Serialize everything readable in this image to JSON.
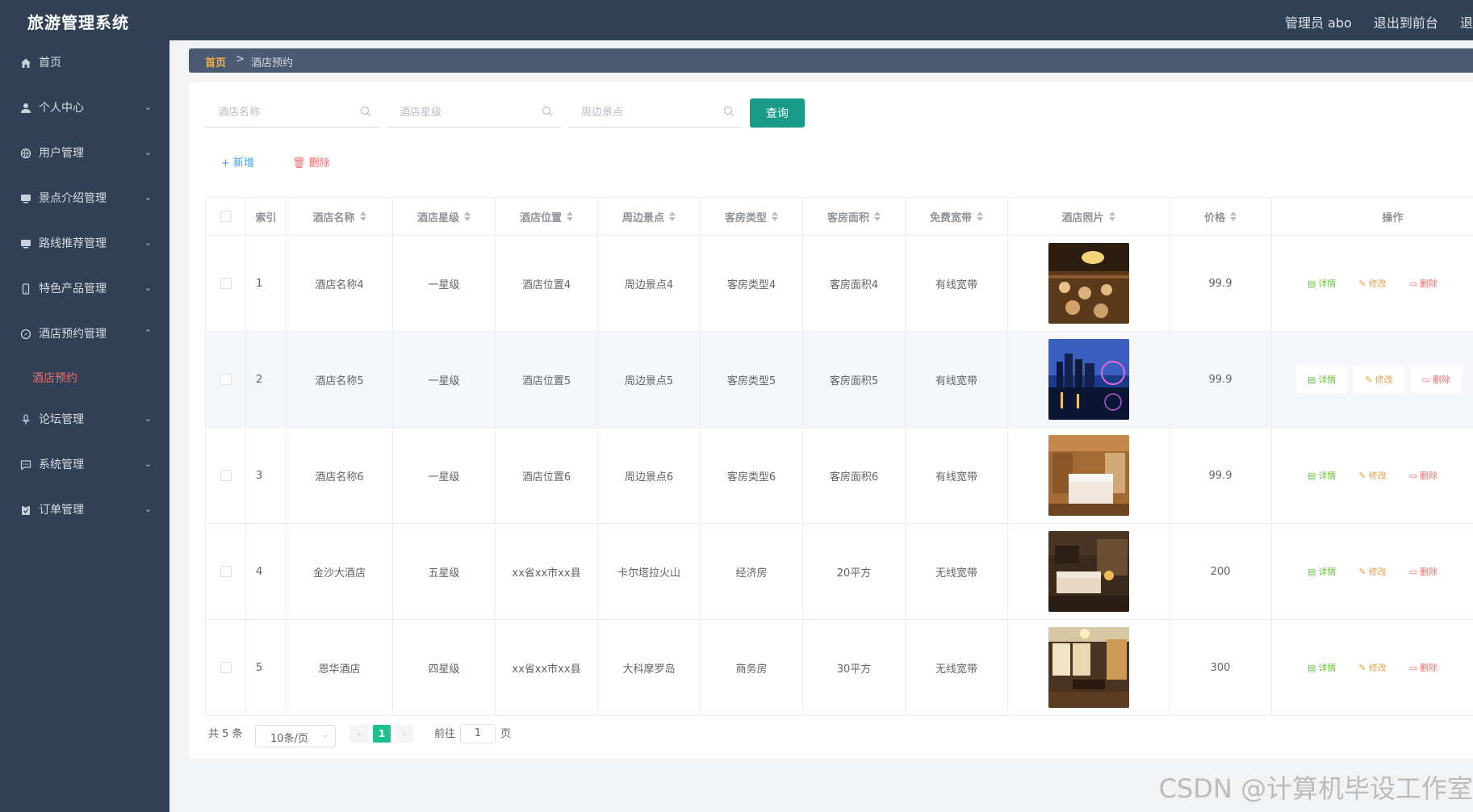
{
  "header": {
    "app_title": "旅游管理系统",
    "user_label": "管理员 abo",
    "front_link": "退出到前台",
    "logout": "退"
  },
  "sidebar": {
    "items": [
      {
        "label": "首页",
        "icon": "home-icon"
      },
      {
        "label": "个人中心",
        "icon": "user-icon"
      },
      {
        "label": "用户管理",
        "icon": "globe-icon"
      },
      {
        "label": "景点介绍管理",
        "icon": "monitor-icon"
      },
      {
        "label": "路线推荐管理",
        "icon": "monitor-icon"
      },
      {
        "label": "特色产品管理",
        "icon": "phone-icon"
      },
      {
        "label": "酒店预约管理",
        "icon": "compass-icon"
      },
      {
        "label": "论坛管理",
        "icon": "mic-icon"
      },
      {
        "label": "系统管理",
        "icon": "chat-icon"
      },
      {
        "label": "订单管理",
        "icon": "clipboard-icon"
      }
    ],
    "active_sub": "酒店预约"
  },
  "breadcrumb": {
    "home": "首页",
    "separator": ">",
    "current": "酒店预约"
  },
  "search": {
    "hotel_name_placeholder": "酒店名称",
    "hotel_star_placeholder": "酒店星级",
    "nearby_placeholder": "周边景点",
    "query_label": "查询"
  },
  "toolbar": {
    "add_label": "新增",
    "delete_label": "删除"
  },
  "table": {
    "columns": [
      "索引",
      "酒店名称",
      "酒店星级",
      "酒店位置",
      "周边景点",
      "客房类型",
      "客房面积",
      "免费宽带",
      "酒店照片",
      "价格",
      "操作"
    ],
    "rows": [
      {
        "index": "1",
        "name": "酒店名称4",
        "star": "一星级",
        "location": "酒店位置4",
        "nearby": "周边景点4",
        "room_type": "客房类型4",
        "area": "客房面积4",
        "broadband": "有线宽带",
        "photo": "banquet-hall",
        "price": "99.9"
      },
      {
        "index": "2",
        "name": "酒店名称5",
        "star": "一星级",
        "location": "酒店位置5",
        "nearby": "周边景点5",
        "room_type": "客房类型5",
        "area": "客房面积5",
        "broadband": "有线宽带",
        "photo": "city-night",
        "price": "99.9"
      },
      {
        "index": "3",
        "name": "酒店名称6",
        "star": "一星级",
        "location": "酒店位置6",
        "nearby": "周边景点6",
        "room_type": "客房类型6",
        "area": "客房面积6",
        "broadband": "有线宽带",
        "photo": "bedroom-wood",
        "price": "99.9"
      },
      {
        "index": "4",
        "name": "金沙大酒店",
        "star": "五星级",
        "location": "xx省xx市xx县",
        "nearby": "卡尔塔拉火山",
        "room_type": "经济房",
        "area": "20平方",
        "broadband": "无线宽带",
        "photo": "hotel-suite",
        "price": "200"
      },
      {
        "index": "5",
        "name": "恩华酒店",
        "star": "四星级",
        "location": "xx省xx市xx县",
        "nearby": "大科摩罗岛",
        "room_type": "商务房",
        "area": "30平方",
        "broadband": "无线宽带",
        "photo": "tatami-room",
        "price": "300"
      }
    ],
    "actions": {
      "detail": "详情",
      "edit": "修改",
      "remove": "删除"
    }
  },
  "pagination": {
    "total": "共 5 条",
    "page_size": "10条/页",
    "current_page": "1",
    "goto_label": "前往",
    "goto_value": "1",
    "page_unit": "页"
  },
  "watermark": "CSDN @计算机毕设工作室",
  "colors": {
    "sidebar_bg": "#304156",
    "accent": "#1a9b8a",
    "active_red": "#f56c6c"
  }
}
